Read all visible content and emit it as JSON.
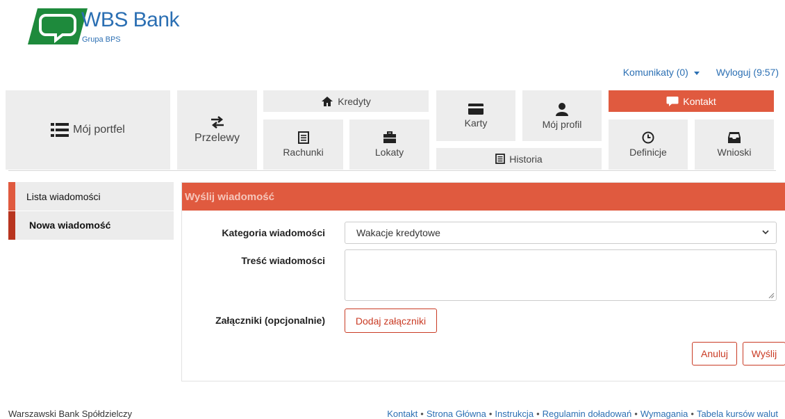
{
  "brand": {
    "name": "WBS Bank",
    "subtitle": "Grupa BPS",
    "color": "#2b6fb3"
  },
  "topbar": {
    "messages_label": "Komunikaty (0)",
    "logout_label": "Wyloguj (9:57)"
  },
  "nav": {
    "portfolio": "Mój portfel",
    "transfers": "Przelewy",
    "loans": "Kredyty",
    "accounts": "Rachunki",
    "deposits": "Lokaty",
    "cards": "Karty",
    "profile": "Mój profil",
    "history": "Historia",
    "contact": "Kontakt",
    "definitions": "Definicje",
    "applications": "Wnioski"
  },
  "sidebar": {
    "items": [
      {
        "label": "Lista wiadomości"
      },
      {
        "label": "Nowa wiadomość"
      }
    ]
  },
  "form": {
    "title": "Wyślij wiadomość",
    "category_label": "Kategoria wiadomości",
    "category_value": "Wakacje kredytowe",
    "content_label": "Treść wiadomości",
    "attachments_label": "Załączniki (opcjonalnie)",
    "add_attachments": "Dodaj załączniki",
    "cancel": "Anuluj",
    "send": "Wyślij"
  },
  "footer": {
    "bank_name": "Warszawski Bank Spółdzielczy",
    "links": [
      "Kontakt",
      "Strona Główna",
      "Instrukcja",
      "Regulamin doładowań",
      "Wymagania",
      "Tabela kursów walut"
    ]
  },
  "colors": {
    "accent": "#e05a3f",
    "accent_dark": "#b8351f",
    "link": "#2b6fb3",
    "tile": "#ededed"
  }
}
